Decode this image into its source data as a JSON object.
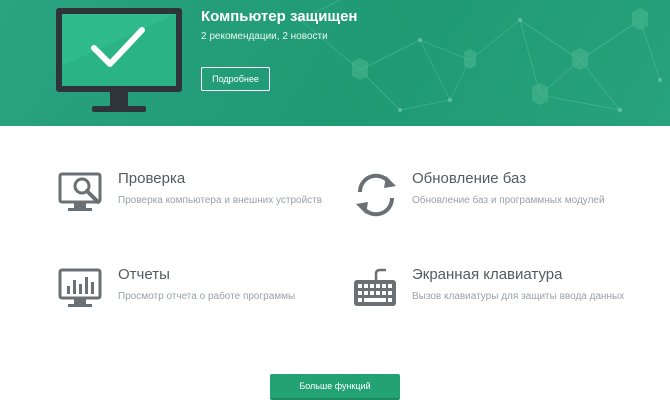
{
  "header": {
    "status_title": "Компьютер защищен",
    "status_subtitle": "2 рекомендации, 2 новости",
    "details_button": "Подробнее",
    "background_color": "#25a07a"
  },
  "tiles": [
    {
      "icon": "scan-icon",
      "title": "Проверка",
      "description": "Проверка компьютера и внешних устройств"
    },
    {
      "icon": "update-icon",
      "title": "Обновление баз",
      "description": "Обновление баз и программных модулей"
    },
    {
      "icon": "reports-icon",
      "title": "Отчеты",
      "description": "Просмотр отчета о работе программы"
    },
    {
      "icon": "keyboard-icon",
      "title": "Экранная клавиатура",
      "description": "Вызов клавиатуры для защиты ввода данных"
    }
  ],
  "footer": {
    "more_button": "Больше функций",
    "accent_color": "#23a275"
  },
  "colors": {
    "icon_gray": "#6a7074",
    "title_text": "#555a5e",
    "description_text": "#9aa1a6"
  }
}
